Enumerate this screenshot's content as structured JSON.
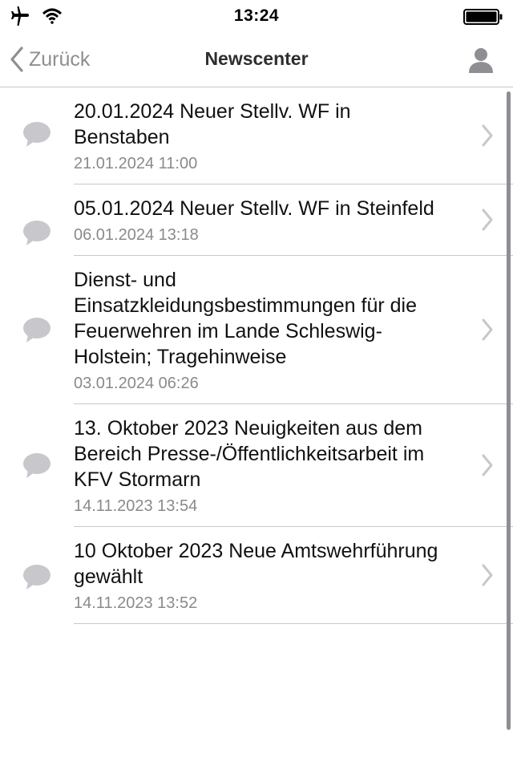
{
  "status_bar": {
    "time": "13:24",
    "icons": [
      "airplane-icon",
      "wifi-icon",
      "battery-icon"
    ]
  },
  "nav": {
    "back_label": "Zurück",
    "title": "Newscenter",
    "profile_icon": "person-icon"
  },
  "news": [
    {
      "title": "20.01.2024 Neuer Stellv. WF in Benstaben",
      "date": "21.01.2024 11:00"
    },
    {
      "title": "05.01.2024 Neuer Stellv. WF in Steinfeld",
      "date": "06.01.2024 13:18"
    },
    {
      "title": "Dienst- und Einsatzkleidungsbestimmungen für die Feuerwehren im Lande Schleswig-Holstein; Tragehinweise",
      "date": "03.01.2024 06:26"
    },
    {
      "title": "13. Oktober 2023 Neuigkeiten aus dem Bereich Presse-/Öffentlichkeitsarbeit im KFV Stormarn",
      "date": "14.11.2023 13:54"
    },
    {
      "title": "10 Oktober 2023 Neue Amtswehrführung gewählt",
      "date": "14.11.2023 13:52"
    }
  ],
  "colors": {
    "accent_gray": "#8e8e93",
    "icon_gray": "#c7c7cc",
    "separator": "#c8c8cc"
  }
}
